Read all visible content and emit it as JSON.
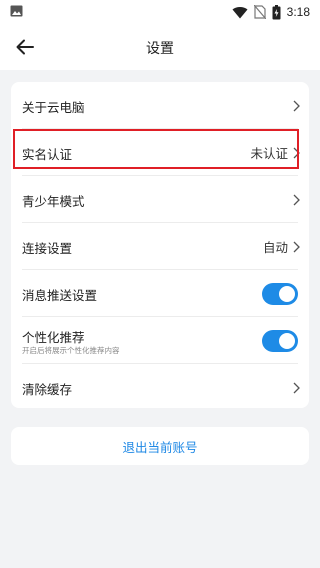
{
  "status_bar": {
    "time": "3:18",
    "icons": [
      "image-icon",
      "wifi-icon",
      "no-sim-icon",
      "battery-icon"
    ]
  },
  "app_bar": {
    "title": "设置",
    "back_icon": "arrow-left-icon"
  },
  "settings": {
    "items": [
      {
        "label": "关于云电脑",
        "value": "",
        "control": "chevron"
      },
      {
        "label": "实名认证",
        "value": "未认证",
        "control": "chevron",
        "highlighted": true
      },
      {
        "label": "青少年模式",
        "value": "",
        "control": "chevron"
      },
      {
        "label": "连接设置",
        "value": "自动",
        "control": "chevron"
      },
      {
        "label": "消息推送设置",
        "value": "",
        "control": "toggle",
        "on": true
      },
      {
        "label": "个性化推荐",
        "sub": "开启后将展示个性化推荐内容",
        "control": "toggle",
        "on": true
      },
      {
        "label": "清除缓存",
        "value": "",
        "control": "chevron"
      }
    ]
  },
  "logout": {
    "label": "退出当前账号"
  },
  "colors": {
    "accent": "#1e8be6",
    "highlight_border": "#e01f26",
    "background": "#f2f3f5"
  }
}
